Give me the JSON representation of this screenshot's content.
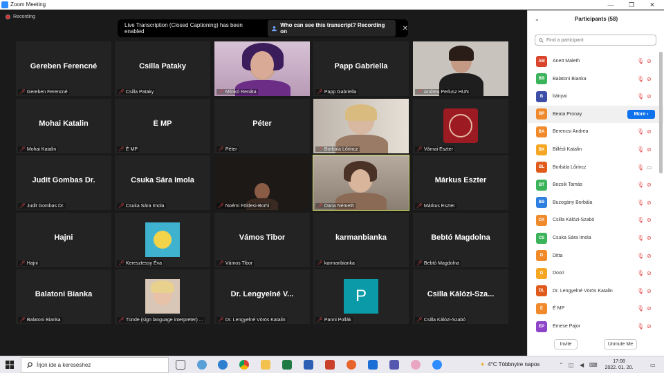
{
  "window": {
    "title": "Zoom Meeting",
    "minimize": "—",
    "maximize": "❐",
    "close": "✕"
  },
  "recording": {
    "label": "Recording"
  },
  "banner": {
    "text": "Live Transcription (Closed Captioning) has been enabled",
    "who_label": "Who can see this transcript? Recording on",
    "close": "✕"
  },
  "tiles": [
    {
      "name": "Gereben Ferencné",
      "label": "Gereben Ferencné",
      "video": false
    },
    {
      "name": "Csilla Pataky",
      "label": "Csilla Pataky",
      "video": false
    },
    {
      "name": "",
      "label": "Mlinkó Renáta",
      "video": true,
      "kind": "person-purple"
    },
    {
      "name": "Papp Gabriella",
      "label": "Papp Gabriella",
      "video": false
    },
    {
      "name": "",
      "label": "Andrea Perlusz HUN",
      "video": true,
      "kind": "person-dark"
    },
    {
      "name": "Mohai Katalin",
      "label": "Mohai Katalin",
      "video": false
    },
    {
      "name": "É MP",
      "label": "É MP",
      "video": false
    },
    {
      "name": "Péter",
      "label": "Péter",
      "video": false
    },
    {
      "name": "",
      "label": "Borbála Lőrincz",
      "video": true,
      "kind": "person-blonde"
    },
    {
      "name": "",
      "label": "Várnai Eszter",
      "video": true,
      "kind": "emblem"
    },
    {
      "name": "Judit Gombas Dr.",
      "label": "Judit Gombas Dr.",
      "video": false
    },
    {
      "name": "Csuka Sára Imola",
      "label": "Csuka Sára Imola",
      "video": false
    },
    {
      "name": "",
      "label": "Noémi Földesi-Borhi",
      "video": true,
      "kind": "person-darkroom"
    },
    {
      "name": "",
      "label": "Dana Németh",
      "video": true,
      "kind": "person-speaking",
      "active": true
    },
    {
      "name": "Márkus Eszter",
      "label": "Márkus Eszter",
      "video": false
    },
    {
      "name": "Hajni",
      "label": "Hajni",
      "video": false
    },
    {
      "name": "",
      "label": "Keresztessy Éva",
      "video": true,
      "kind": "graphic"
    },
    {
      "name": "Vámos Tibor",
      "label": "Vámos Tibor",
      "video": false
    },
    {
      "name": "karmanbianka",
      "label": "karmanbianka",
      "video": false
    },
    {
      "name": "Bebtó Magdolna",
      "label": "Bebtó Magdolna",
      "video": false
    },
    {
      "name": "Balatoni Bianka",
      "label": "Balatoni Bianka",
      "video": false
    },
    {
      "name": "",
      "label": "Tünde (sign language interpreter) ...",
      "video": true,
      "kind": "portrait"
    },
    {
      "name": "Dr. Lengyelné V...",
      "label": "Dr. Lengyelné Vörös Katalin",
      "video": false
    },
    {
      "name": "",
      "label": "Panni Pollák",
      "video": true,
      "kind": "avatar-p",
      "letter": "P"
    },
    {
      "name": "Csilla  Kálózi-Sza...",
      "label": "Csilla Kálózi-Szabó",
      "video": false
    }
  ],
  "sidebar": {
    "title": "Participants (58)",
    "collapse": "⌄",
    "search_placeholder": "Find a participant",
    "more_label": "More ›",
    "participants": [
      {
        "initials": "AM",
        "name": "Anett Maleth",
        "color": "#d9452c",
        "cam": "off"
      },
      {
        "initials": "BB",
        "name": "Balatoni Bianka",
        "color": "#3bb35a",
        "cam": "off"
      },
      {
        "initials": "B",
        "name": "bányai",
        "color": "#3c4ea6",
        "cam": "off"
      },
      {
        "initials": "BP",
        "name": "Beata Pronay",
        "color": "#f0892b",
        "more": true
      },
      {
        "initials": "BA",
        "name": "Berencsi Andrea",
        "color": "#f08a2b",
        "cam": "off"
      },
      {
        "initials": "BK",
        "name": "Billédi Katalin",
        "color": "#f5a623",
        "cam": "off"
      },
      {
        "initials": "BL",
        "name": "Borbála Lőrincz",
        "color": "#e05a1c",
        "cam": "on"
      },
      {
        "initials": "BT",
        "name": "Bozsik Tamás",
        "color": "#3bb35a",
        "cam": "off"
      },
      {
        "initials": "BB",
        "name": "Buzogány Borbála",
        "color": "#2d7fe0",
        "cam": "off"
      },
      {
        "initials": "CK",
        "name": "Csilla Kálózi-Szabó",
        "color": "#f08a2b",
        "cam": "off"
      },
      {
        "initials": "CS",
        "name": "Csuka Sára Imola",
        "color": "#3bb35a",
        "cam": "off"
      },
      {
        "initials": "D",
        "name": "Ditta",
        "color": "#f08a2b",
        "cam": "off"
      },
      {
        "initials": "D",
        "name": "Doori",
        "color": "#f5a623",
        "cam": "off"
      },
      {
        "initials": "DL",
        "name": "Dr. Lengyelné Vörös Katalin",
        "color": "#e05a1c",
        "cam": "off"
      },
      {
        "initials": "É",
        "name": "É MP",
        "color": "#f08a2b",
        "cam": "off"
      },
      {
        "initials": "EP",
        "name": "Emese Pajor",
        "color": "#8e44c9",
        "cam": "off"
      }
    ],
    "invite_label": "Invite",
    "unmute_label": "Unmute Me"
  },
  "taskbar": {
    "search_placeholder": "Írjon ide a kereséshez",
    "weather": "4°C  Többnyire napos",
    "time": "17:08",
    "date": "2022. 01. 20."
  }
}
